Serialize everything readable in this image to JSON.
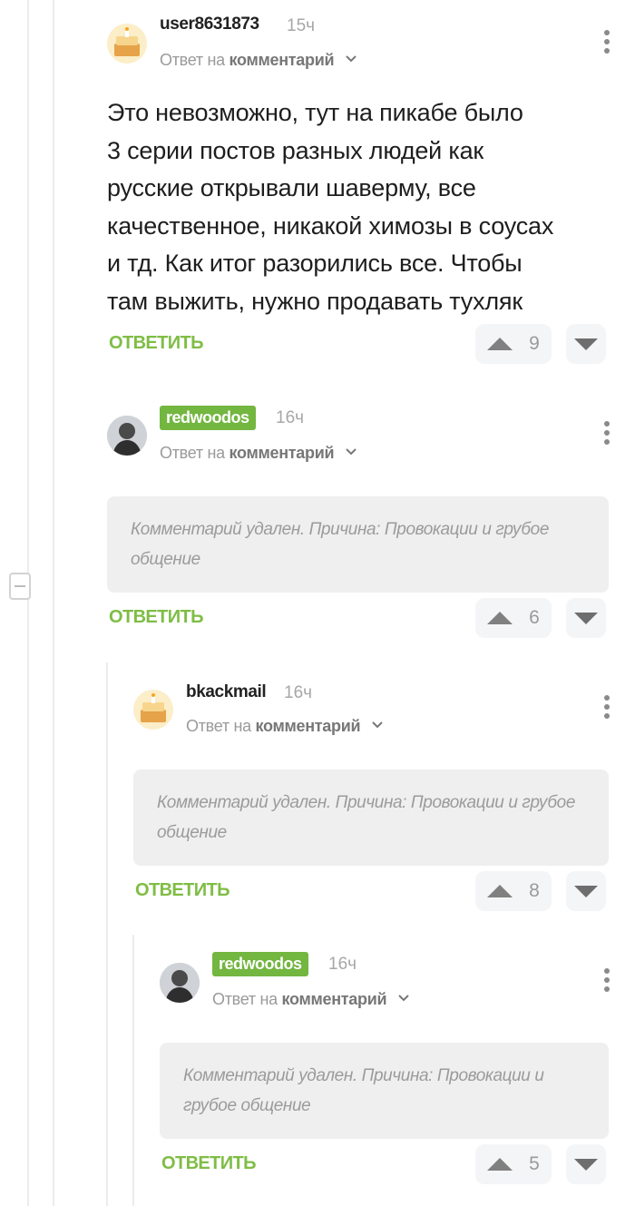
{
  "ui": {
    "reply_label": "ОТВЕТИТЬ",
    "reply_to_prefix": "Ответ на",
    "reply_to_link": "комментарий"
  },
  "comments": [
    {
      "user": "user8631873",
      "time": "15ч",
      "avatar": "cake-avatar",
      "text_lines": [
        "Это невозможно, тут на пикабе было",
        "3 серии постов разных людей как",
        "русские открывали шаверму, все",
        "качественное, никакой химозы в соусах",
        "и тд. Как итог разорились все. Чтобы",
        "там выжить, нужно продавать тухляк"
      ],
      "rating": "9"
    },
    {
      "user": "redwoodos",
      "time": "16ч",
      "avatar": "photo-avatar",
      "highlighted": true,
      "deleted_text": "Комментарий удален. Причина: Провокации и грубое общение",
      "rating": "6"
    },
    {
      "user": "bkackmail",
      "time": "16ч",
      "avatar": "cake-avatar",
      "deleted_text": "Комментарий удален. Причина: Провокации и грубое общение",
      "rating": "8"
    },
    {
      "user": "redwoodos",
      "time": "16ч",
      "avatar": "photo-avatar",
      "highlighted": true,
      "deleted_text": "Комментарий удален. Причина: Провокации и грубое общение",
      "rating": "5"
    }
  ],
  "colors": {
    "accent": "#7fbd45",
    "badge": "#73b640",
    "deleted_bg": "#efefef",
    "muted": "#9b9b9b"
  }
}
